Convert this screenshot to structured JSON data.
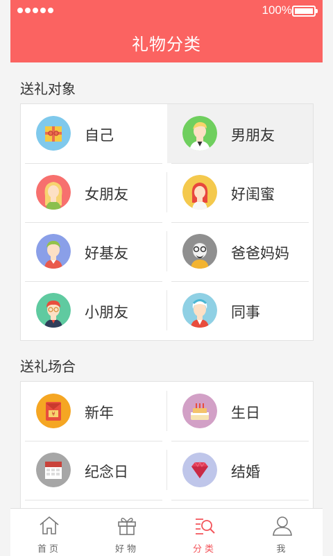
{
  "status_bar": {
    "signal": "●●●●●",
    "battery": "100%"
  },
  "header": {
    "title": "礼物分类"
  },
  "sections": [
    {
      "title": "送礼对象",
      "items": [
        {
          "label": "自己",
          "icon": "gift-box-icon",
          "color": "#7fc9ec"
        },
        {
          "label": "男朋友",
          "icon": "boyfriend-avatar-icon",
          "color": "#6fcf5e",
          "active": true
        },
        {
          "label": "女朋友",
          "icon": "girlfriend-avatar-icon",
          "color": "#f7706e"
        },
        {
          "label": "好闺蜜",
          "icon": "bestie-avatar-icon",
          "color": "#f4c94d"
        },
        {
          "label": "好基友",
          "icon": "buddy-avatar-icon",
          "color": "#8a9fe8"
        },
        {
          "label": "爸爸妈妈",
          "icon": "parents-avatar-icon",
          "color": "#8f8f8f"
        },
        {
          "label": "小朋友",
          "icon": "kid-avatar-icon",
          "color": "#5fcaa0"
        },
        {
          "label": "同事",
          "icon": "colleague-avatar-icon",
          "color": "#8fd0e4"
        }
      ]
    },
    {
      "title": "送礼场合",
      "items": [
        {
          "label": "新年",
          "icon": "red-envelope-icon",
          "color": "#f5a623"
        },
        {
          "label": "生日",
          "icon": "birthday-cake-icon",
          "color": "#d2a0c6"
        },
        {
          "label": "纪念日",
          "icon": "calendar-icon",
          "color": "#a6a6a6"
        },
        {
          "label": "结婚",
          "icon": "diamond-icon",
          "color": "#9fa8e0"
        }
      ]
    }
  ],
  "tabbar": {
    "items": [
      {
        "label": "首页",
        "icon": "home-icon"
      },
      {
        "label": "好物",
        "icon": "gift-icon"
      },
      {
        "label": "分类",
        "icon": "category-search-icon",
        "active": true
      },
      {
        "label": "我",
        "icon": "user-icon"
      }
    ],
    "active_color": "#f3545a"
  }
}
